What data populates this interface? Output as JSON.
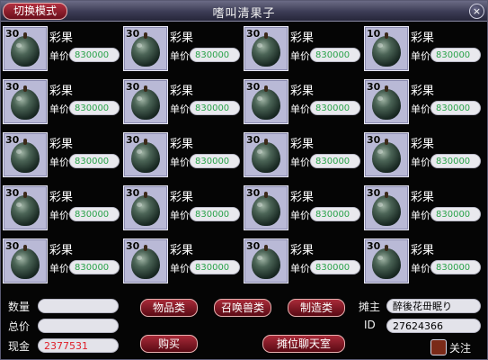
{
  "window": {
    "title": "嗜叫清果子",
    "mode_button": "切换模式",
    "close_glyph": "×"
  },
  "items": [
    {
      "qty": "30",
      "name": "彩果",
      "price_label": "单价",
      "price": "830000"
    },
    {
      "qty": "30",
      "name": "彩果",
      "price_label": "单价",
      "price": "830000"
    },
    {
      "qty": "30",
      "name": "彩果",
      "price_label": "单价",
      "price": "830000"
    },
    {
      "qty": "10",
      "name": "彩果",
      "price_label": "单价",
      "price": "830000"
    },
    {
      "qty": "30",
      "name": "彩果",
      "price_label": "单价",
      "price": "830000"
    },
    {
      "qty": "30",
      "name": "彩果",
      "price_label": "单价",
      "price": "830000"
    },
    {
      "qty": "30",
      "name": "彩果",
      "price_label": "单价",
      "price": "830000"
    },
    {
      "qty": "30",
      "name": "彩果",
      "price_label": "单价",
      "price": "830000"
    },
    {
      "qty": "30",
      "name": "彩果",
      "price_label": "单价",
      "price": "830000"
    },
    {
      "qty": "30",
      "name": "彩果",
      "price_label": "单价",
      "price": "830000"
    },
    {
      "qty": "30",
      "name": "彩果",
      "price_label": "单价",
      "price": "830000"
    },
    {
      "qty": "30",
      "name": "彩果",
      "price_label": "单价",
      "price": "830000"
    },
    {
      "qty": "30",
      "name": "彩果",
      "price_label": "单价",
      "price": "830000"
    },
    {
      "qty": "30",
      "name": "彩果",
      "price_label": "单价",
      "price": "830000"
    },
    {
      "qty": "30",
      "name": "彩果",
      "price_label": "单价",
      "price": "830000"
    },
    {
      "qty": "30",
      "name": "彩果",
      "price_label": "单价",
      "price": "830000"
    },
    {
      "qty": "30",
      "name": "彩果",
      "price_label": "单价",
      "price": "830000"
    },
    {
      "qty": "30",
      "name": "彩果",
      "price_label": "单价",
      "price": "830000"
    },
    {
      "qty": "30",
      "name": "彩果",
      "price_label": "单价",
      "price": "830000"
    },
    {
      "qty": "30",
      "name": "彩果",
      "price_label": "单价",
      "price": "830000"
    }
  ],
  "bottom": {
    "quantity_label": "数量",
    "quantity_value": "",
    "total_label": "总价",
    "total_value": "",
    "cash_label": "现金",
    "cash_value": "2377531",
    "btn_items": "物品类",
    "btn_pets": "召唤兽类",
    "btn_crafting": "制造类",
    "btn_buy": "购买",
    "btn_chat": "摊位聊天室",
    "owner_label": "摊主",
    "owner_name": "醉後花毌眠り",
    "id_label": "ID",
    "id_value": "27624366",
    "follow_label": "关注"
  },
  "colors": {
    "price_text": "#2aa34a",
    "cash_text": "#e0202a",
    "button_red": "#a82a38"
  },
  "icons": {
    "item_icon": "fruit-icon"
  }
}
